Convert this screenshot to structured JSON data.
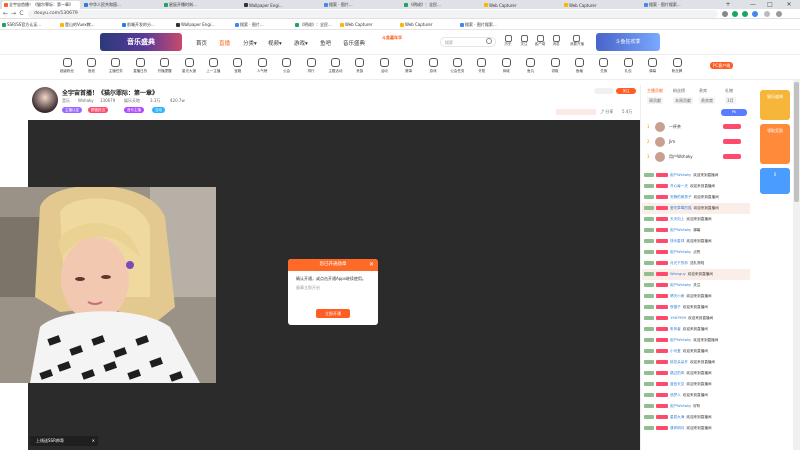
{
  "browser": {
    "tabs": [
      {
        "label": "全宇宙首播！《猫尔罪际：第一章》",
        "fav": "#ff5d23",
        "active": true
      },
      {
        "label": "中华人民共和国...",
        "fav": "#2b7be4"
      },
      {
        "label": "星辰开播时刻...",
        "fav": "#1da462"
      },
      {
        "label": "Wallpaper Engi...",
        "fav": "#333333"
      },
      {
        "label": "搜索 · 图片...",
        "fav": "#4285f4"
      },
      {
        "label": "《明成》：全民...",
        "fav": "#1da462"
      },
      {
        "label": "Web Capturer",
        "fav": "#ffb400"
      },
      {
        "label": "Web Capturer",
        "fav": "#ffb400"
      },
      {
        "label": "搜索 · 图片搜索...",
        "fav": "#4285f4"
      }
    ],
    "new_tab": "+",
    "window_controls": [
      "—",
      "□",
      "✕"
    ],
    "url": "douyu.com/130679",
    "nav": {
      "back": "←",
      "forward": "→",
      "reload": "C"
    },
    "bookmarks": [
      {
        "label": "SSR/SS官方认证...",
        "fav": "#1da462"
      },
      {
        "label": "登山的Vuex教...",
        "fav": "#ffb400"
      },
      {
        "label": "前端开发的分...",
        "fav": "#2b7be4"
      },
      {
        "label": "Wallpaper Engi...",
        "fav": "#333333"
      },
      {
        "label": "搜索 · 图片...",
        "fav": "#4285f4"
      },
      {
        "label": "《明成》：全民...",
        "fav": "#1da462"
      },
      {
        "label": "Web Capturer",
        "fav": "#ffb400"
      },
      {
        "label": "Web Capturer",
        "fav": "#ffb400"
      },
      {
        "label": "搜索 · 图片搜索...",
        "fav": "#4285f4"
      }
    ]
  },
  "header": {
    "banner_text": "音乐盛典",
    "nav": [
      {
        "label": "首页",
        "active": false
      },
      {
        "label": "直播",
        "active": true
      },
      {
        "label": "分类▾",
        "active": false
      },
      {
        "label": "视频▾",
        "active": false
      },
      {
        "label": "游戏▾",
        "active": false
      },
      {
        "label": "鱼吧",
        "active": false
      },
      {
        "label": "音乐盛典",
        "active": false
      }
    ],
    "promo": "斗鱼嘉年华",
    "search_placeholder": "搜索",
    "icons": [
      {
        "name": "history-icon",
        "label": "历史"
      },
      {
        "name": "follow-icon",
        "label": "关注"
      },
      {
        "name": "download-icon",
        "label": "客户端"
      },
      {
        "name": "message-icon",
        "label": "消息"
      },
      {
        "name": "broadcast-icon",
        "label": "我要开播"
      }
    ],
    "banner2_text": "斗鱼狂欢季"
  },
  "catbar": {
    "level": "12",
    "level_label": "主播等级",
    "items": [
      "超级粉丝",
      "音浪",
      "主播任务",
      "直播日历",
      "开播提醒",
      "星光大道",
      "上一主播",
      "宝箱",
      "人气榜",
      "公会",
      "排行",
      "主题活动",
      "贵族",
      "活动",
      "赛事",
      "游戏",
      "公会任务",
      "许愿",
      "商城",
      "鱼丸",
      "领取",
      "鱼塘",
      "兑换",
      "礼包",
      "弹幕",
      "粉丝牌"
    ],
    "pc_badge": "PC客户端"
  },
  "stream": {
    "title": "全宇宙首播！《猫尔罪际：第一章》",
    "category": "音乐",
    "room_tag": "娱乐天地",
    "streamer": "Wshaky",
    "room_id": "130679",
    "popularity": "3.3万",
    "fans": "420.7w",
    "pills": [
      {
        "label": "主播认证",
        "color": "#9a6aff"
      },
      {
        "label": "颜值担当",
        "color": "#ff4a6e"
      },
      {
        "label": "音乐主播",
        "color": "#b04aff"
      },
      {
        "label": "互动",
        "color": "#2ab5ff"
      }
    ],
    "follow_label": "关注",
    "follow_count": "5.4万"
  },
  "modal": {
    "title": "您已开通勋章",
    "body": "确认开通，或点击开通Apps继续使用。",
    "sub": "勋章立即开启",
    "button": "立即开通",
    "close": "✕"
  },
  "video_tip": "上线送SSR帅哥",
  "rightpanel": {
    "tabs": [
      "主播贡献",
      "粉丝榜",
      "贵宾",
      "礼物"
    ],
    "sub_tabs": [
      "周贡献",
      "本周贡献",
      "贵宾席",
      "3月"
    ],
    "rank": [
      {
        "num": "1",
        "name": "一杯茶"
      },
      {
        "num": "2",
        "name": "Jim"
      },
      {
        "num": "3",
        "name": "用户Wshaky"
      }
    ],
    "pk_label": "PK"
  },
  "chat": [
    {
      "user": "用户Wshaky",
      "text": "欢迎来到直播间",
      "hl": false
    },
    {
      "user": "开心每一天",
      "text": "欢迎来到直播间",
      "hl": false
    },
    {
      "user": "安静的美男子",
      "text": "欢迎来到直播间",
      "hl": false
    },
    {
      "user": "爱吃草莓的猫",
      "text": "欢迎来到直播间",
      "hl": true
    },
    {
      "user": "天天向上",
      "text": "欢迎来到直播间",
      "hl": false
    },
    {
      "user": "用户Wshaky",
      "text": "弹幕",
      "hl": false
    },
    {
      "user": "快乐星球",
      "text": "欢迎来到直播间",
      "hl": false
    },
    {
      "user": "用户Wshaky",
      "text": "点赞",
      "hl": false
    },
    {
      "user": "月光下的你",
      "text": "送礼物啦",
      "hl": false
    },
    {
      "user": "Wlanguy",
      "text": "欢迎来到直播间",
      "hl": true
    },
    {
      "user": "用户Wshaky",
      "text": "关注",
      "hl": false
    },
    {
      "user": "晴天小雨",
      "text": "欢迎来到直播间",
      "hl": false
    },
    {
      "user": "夜猫子",
      "text": "欢迎来到直播间",
      "hl": false
    },
    {
      "user": "1987999",
      "text": "欢迎来到直播间",
      "hl": false
    },
    {
      "user": "听风者",
      "text": "欢迎来到直播间",
      "hl": false
    },
    {
      "user": "用户Wshaky",
      "text": "欢迎来到直播间",
      "hl": false
    },
    {
      "user": "小可爱",
      "text": "欢迎来到直播间",
      "hl": false
    },
    {
      "user": "桃花朵朵开",
      "text": "欢迎来到直播间",
      "hl": false
    },
    {
      "user": "路过的风",
      "text": "欢迎来到直播间",
      "hl": false
    },
    {
      "user": "蓝色天空",
      "text": "欢迎来到直播间",
      "hl": false
    },
    {
      "user": "追梦人",
      "text": "欢迎来到直播间",
      "hl": false
    },
    {
      "user": "用户Wshaky",
      "text": "好听",
      "hl": false
    },
    {
      "user": "星辰大海",
      "text": "欢迎来到直播间",
      "hl": false
    },
    {
      "user": "清风明月",
      "text": "欢迎来到直播间",
      "hl": false
    }
  ],
  "sidewidgets": [
    {
      "label": "猫乐盛典",
      "color": "#f5b63a"
    },
    {
      "label": "领取奖励",
      "color": "#ff8a3a"
    },
    {
      "label": "0",
      "color": "#4a9cff"
    }
  ]
}
